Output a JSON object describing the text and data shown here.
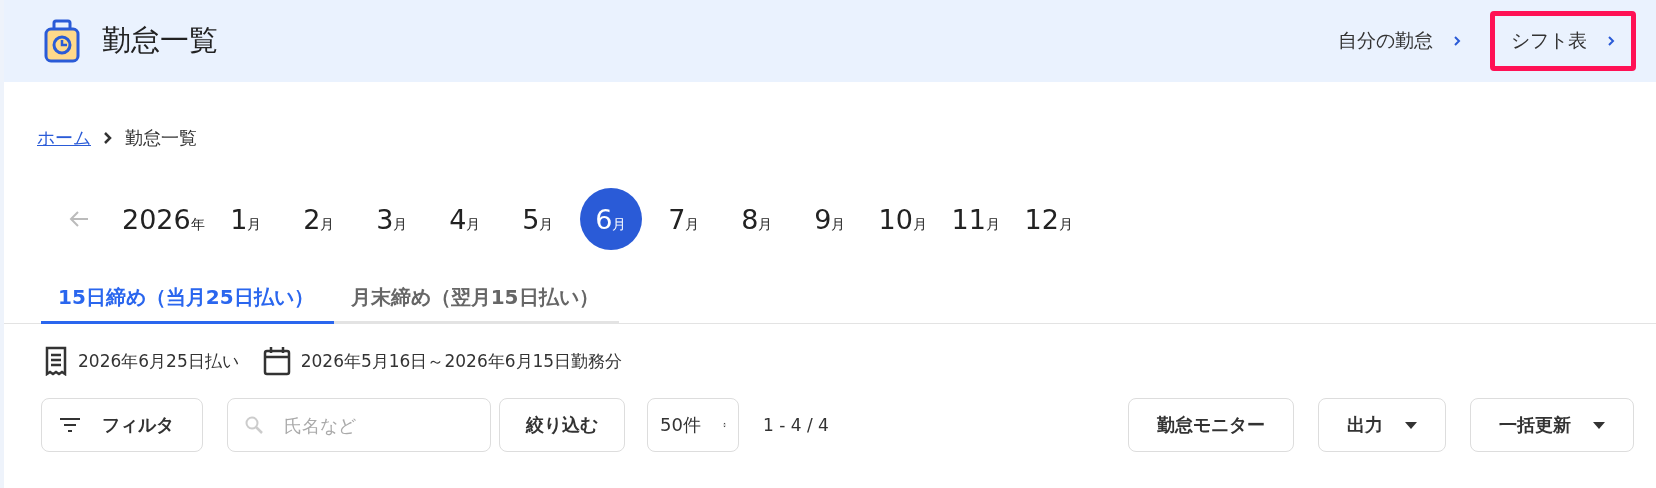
{
  "header": {
    "title": "勤怠一覧",
    "links": [
      {
        "label": "自分の勤怠",
        "highlighted": false
      },
      {
        "label": "シフト表",
        "highlighted": true
      }
    ]
  },
  "breadcrumb": {
    "home": "ホーム",
    "current": "勤怠一覧"
  },
  "year": {
    "number": "2026",
    "unit": "年"
  },
  "months": [
    {
      "number": "1",
      "unit": "月",
      "selected": false
    },
    {
      "number": "2",
      "unit": "月",
      "selected": false
    },
    {
      "number": "3",
      "unit": "月",
      "selected": false
    },
    {
      "number": "4",
      "unit": "月",
      "selected": false
    },
    {
      "number": "5",
      "unit": "月",
      "selected": false
    },
    {
      "number": "6",
      "unit": "月",
      "selected": true
    },
    {
      "number": "7",
      "unit": "月",
      "selected": false
    },
    {
      "number": "8",
      "unit": "月",
      "selected": false
    },
    {
      "number": "9",
      "unit": "月",
      "selected": false
    },
    {
      "number": "10",
      "unit": "月",
      "selected": false
    },
    {
      "number": "11",
      "unit": "月",
      "selected": false
    },
    {
      "number": "12",
      "unit": "月",
      "selected": false
    }
  ],
  "tabs": [
    {
      "label": "15日締め（当月25日払い）",
      "selected": true
    },
    {
      "label": "月末締め（翌月15日払い）",
      "selected": false
    }
  ],
  "info": {
    "payday": "2026年6月25日払い",
    "period": "2026年5月16日～2026年6月15日勤務分"
  },
  "toolbar": {
    "filter": "フィルタ",
    "search_placeholder": "氏名など",
    "apply": "絞り込む",
    "page_size": "50件",
    "range": "1 - 4 / 4",
    "buttons": [
      {
        "label": "勤怠モニター",
        "kind": "plain"
      },
      {
        "label": "出力",
        "kind": "dropdown"
      },
      {
        "label": "一括更新",
        "kind": "dropdown"
      }
    ]
  }
}
